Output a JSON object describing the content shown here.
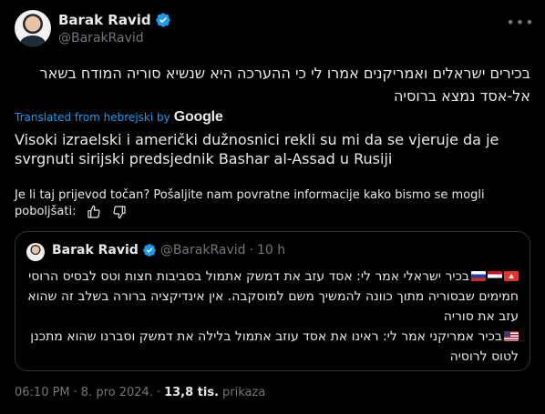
{
  "author": {
    "display_name": "Barak Ravid",
    "handle": "@BarakRavid"
  },
  "tweet": {
    "hebrew_text": "בכירים ישראלים ואמריקנים אמרו לי כי ההערכה היא שנשיא סוריה המודח בשאר אל-אסד נמצא ברוסיה",
    "translated_from": "Translated from hebrejski by",
    "translator": "Google",
    "translation": "Visoki izraelski i američki dužnosnici rekli su mi da se vjeruje da je svrgnuti sirijski predsjednik Bashar al-Assad u Rusiji",
    "feedback_prompt": "Je li taj prijevod točan? Pošaljite nam povratne informacije kako bismo se mogli poboljšati:"
  },
  "quote": {
    "display_name": "Barak Ravid",
    "handle": "@BarakRavid",
    "dot": "·",
    "time": "10 h",
    "line1": "בכיר ישראלי אמר לי: אסד עזב את דמשק אתמול בסביבות חצות וטס לבסיס הרוסי חמימים שבסוריה מתוך כוונה להמשיך משם למוסקבה. אין אינדיקציה ברורה בשלב זה שהוא עזב את סוריה",
    "line2": "בכיר אמריקני אמר לי: ראינו את אסד עוזב אתמול בלילה את דמשק וסברנו שהוא מתכנן לטוס לרוסיה"
  },
  "meta": {
    "time": "06:10 PM",
    "sep1": "·",
    "date": "8. pro 2024.",
    "sep2": "·",
    "views_count": "13,8 tis.",
    "views_label": "prikaza"
  },
  "colors": {
    "background": "#000000",
    "accent": "#1d9bf0",
    "muted": "#71767b",
    "border": "#2f3336"
  },
  "icons": {
    "verified": "verified-badge-icon",
    "more": "more-options-icon",
    "thumbs_up": "thumbs-up-icon",
    "thumbs_down": "thumbs-down-icon"
  }
}
